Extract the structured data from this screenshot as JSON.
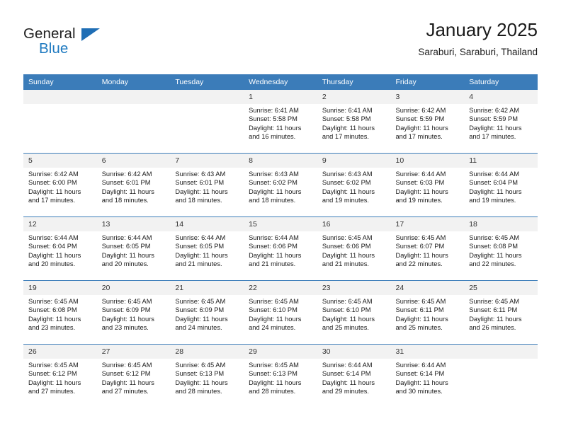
{
  "brand": {
    "name_part1": "General",
    "name_part2": "Blue",
    "accent_color": "#1f7ac0",
    "logo_icon": "triangle-logo-icon"
  },
  "header": {
    "title": "January 2025",
    "subtitle": "Saraburi, Saraburi, Thailand"
  },
  "calendar": {
    "header_bg": "#3b7cb9",
    "daynum_bg": "#f2f2f2",
    "weekday_headers": [
      "Sunday",
      "Monday",
      "Tuesday",
      "Wednesday",
      "Thursday",
      "Friday",
      "Saturday"
    ],
    "weeks": [
      [
        {
          "day": "",
          "empty": true
        },
        {
          "day": "",
          "empty": true
        },
        {
          "day": "",
          "empty": true
        },
        {
          "day": "1",
          "sunrise": "Sunrise: 6:41 AM",
          "sunset": "Sunset: 5:58 PM",
          "daylight_line1": "Daylight: 11 hours",
          "daylight_line2": "and 16 minutes."
        },
        {
          "day": "2",
          "sunrise": "Sunrise: 6:41 AM",
          "sunset": "Sunset: 5:58 PM",
          "daylight_line1": "Daylight: 11 hours",
          "daylight_line2": "and 17 minutes."
        },
        {
          "day": "3",
          "sunrise": "Sunrise: 6:42 AM",
          "sunset": "Sunset: 5:59 PM",
          "daylight_line1": "Daylight: 11 hours",
          "daylight_line2": "and 17 minutes."
        },
        {
          "day": "4",
          "sunrise": "Sunrise: 6:42 AM",
          "sunset": "Sunset: 5:59 PM",
          "daylight_line1": "Daylight: 11 hours",
          "daylight_line2": "and 17 minutes."
        }
      ],
      [
        {
          "day": "5",
          "sunrise": "Sunrise: 6:42 AM",
          "sunset": "Sunset: 6:00 PM",
          "daylight_line1": "Daylight: 11 hours",
          "daylight_line2": "and 17 minutes."
        },
        {
          "day": "6",
          "sunrise": "Sunrise: 6:42 AM",
          "sunset": "Sunset: 6:01 PM",
          "daylight_line1": "Daylight: 11 hours",
          "daylight_line2": "and 18 minutes."
        },
        {
          "day": "7",
          "sunrise": "Sunrise: 6:43 AM",
          "sunset": "Sunset: 6:01 PM",
          "daylight_line1": "Daylight: 11 hours",
          "daylight_line2": "and 18 minutes."
        },
        {
          "day": "8",
          "sunrise": "Sunrise: 6:43 AM",
          "sunset": "Sunset: 6:02 PM",
          "daylight_line1": "Daylight: 11 hours",
          "daylight_line2": "and 18 minutes."
        },
        {
          "day": "9",
          "sunrise": "Sunrise: 6:43 AM",
          "sunset": "Sunset: 6:02 PM",
          "daylight_line1": "Daylight: 11 hours",
          "daylight_line2": "and 19 minutes."
        },
        {
          "day": "10",
          "sunrise": "Sunrise: 6:44 AM",
          "sunset": "Sunset: 6:03 PM",
          "daylight_line1": "Daylight: 11 hours",
          "daylight_line2": "and 19 minutes."
        },
        {
          "day": "11",
          "sunrise": "Sunrise: 6:44 AM",
          "sunset": "Sunset: 6:04 PM",
          "daylight_line1": "Daylight: 11 hours",
          "daylight_line2": "and 19 minutes."
        }
      ],
      [
        {
          "day": "12",
          "sunrise": "Sunrise: 6:44 AM",
          "sunset": "Sunset: 6:04 PM",
          "daylight_line1": "Daylight: 11 hours",
          "daylight_line2": "and 20 minutes."
        },
        {
          "day": "13",
          "sunrise": "Sunrise: 6:44 AM",
          "sunset": "Sunset: 6:05 PM",
          "daylight_line1": "Daylight: 11 hours",
          "daylight_line2": "and 20 minutes."
        },
        {
          "day": "14",
          "sunrise": "Sunrise: 6:44 AM",
          "sunset": "Sunset: 6:05 PM",
          "daylight_line1": "Daylight: 11 hours",
          "daylight_line2": "and 21 minutes."
        },
        {
          "day": "15",
          "sunrise": "Sunrise: 6:44 AM",
          "sunset": "Sunset: 6:06 PM",
          "daylight_line1": "Daylight: 11 hours",
          "daylight_line2": "and 21 minutes."
        },
        {
          "day": "16",
          "sunrise": "Sunrise: 6:45 AM",
          "sunset": "Sunset: 6:06 PM",
          "daylight_line1": "Daylight: 11 hours",
          "daylight_line2": "and 21 minutes."
        },
        {
          "day": "17",
          "sunrise": "Sunrise: 6:45 AM",
          "sunset": "Sunset: 6:07 PM",
          "daylight_line1": "Daylight: 11 hours",
          "daylight_line2": "and 22 minutes."
        },
        {
          "day": "18",
          "sunrise": "Sunrise: 6:45 AM",
          "sunset": "Sunset: 6:08 PM",
          "daylight_line1": "Daylight: 11 hours",
          "daylight_line2": "and 22 minutes."
        }
      ],
      [
        {
          "day": "19",
          "sunrise": "Sunrise: 6:45 AM",
          "sunset": "Sunset: 6:08 PM",
          "daylight_line1": "Daylight: 11 hours",
          "daylight_line2": "and 23 minutes."
        },
        {
          "day": "20",
          "sunrise": "Sunrise: 6:45 AM",
          "sunset": "Sunset: 6:09 PM",
          "daylight_line1": "Daylight: 11 hours",
          "daylight_line2": "and 23 minutes."
        },
        {
          "day": "21",
          "sunrise": "Sunrise: 6:45 AM",
          "sunset": "Sunset: 6:09 PM",
          "daylight_line1": "Daylight: 11 hours",
          "daylight_line2": "and 24 minutes."
        },
        {
          "day": "22",
          "sunrise": "Sunrise: 6:45 AM",
          "sunset": "Sunset: 6:10 PM",
          "daylight_line1": "Daylight: 11 hours",
          "daylight_line2": "and 24 minutes."
        },
        {
          "day": "23",
          "sunrise": "Sunrise: 6:45 AM",
          "sunset": "Sunset: 6:10 PM",
          "daylight_line1": "Daylight: 11 hours",
          "daylight_line2": "and 25 minutes."
        },
        {
          "day": "24",
          "sunrise": "Sunrise: 6:45 AM",
          "sunset": "Sunset: 6:11 PM",
          "daylight_line1": "Daylight: 11 hours",
          "daylight_line2": "and 25 minutes."
        },
        {
          "day": "25",
          "sunrise": "Sunrise: 6:45 AM",
          "sunset": "Sunset: 6:11 PM",
          "daylight_line1": "Daylight: 11 hours",
          "daylight_line2": "and 26 minutes."
        }
      ],
      [
        {
          "day": "26",
          "sunrise": "Sunrise: 6:45 AM",
          "sunset": "Sunset: 6:12 PM",
          "daylight_line1": "Daylight: 11 hours",
          "daylight_line2": "and 27 minutes."
        },
        {
          "day": "27",
          "sunrise": "Sunrise: 6:45 AM",
          "sunset": "Sunset: 6:12 PM",
          "daylight_line1": "Daylight: 11 hours",
          "daylight_line2": "and 27 minutes."
        },
        {
          "day": "28",
          "sunrise": "Sunrise: 6:45 AM",
          "sunset": "Sunset: 6:13 PM",
          "daylight_line1": "Daylight: 11 hours",
          "daylight_line2": "and 28 minutes."
        },
        {
          "day": "29",
          "sunrise": "Sunrise: 6:45 AM",
          "sunset": "Sunset: 6:13 PM",
          "daylight_line1": "Daylight: 11 hours",
          "daylight_line2": "and 28 minutes."
        },
        {
          "day": "30",
          "sunrise": "Sunrise: 6:44 AM",
          "sunset": "Sunset: 6:14 PM",
          "daylight_line1": "Daylight: 11 hours",
          "daylight_line2": "and 29 minutes."
        },
        {
          "day": "31",
          "sunrise": "Sunrise: 6:44 AM",
          "sunset": "Sunset: 6:14 PM",
          "daylight_line1": "Daylight: 11 hours",
          "daylight_line2": "and 30 minutes."
        },
        {
          "day": "",
          "empty": true
        }
      ]
    ]
  }
}
